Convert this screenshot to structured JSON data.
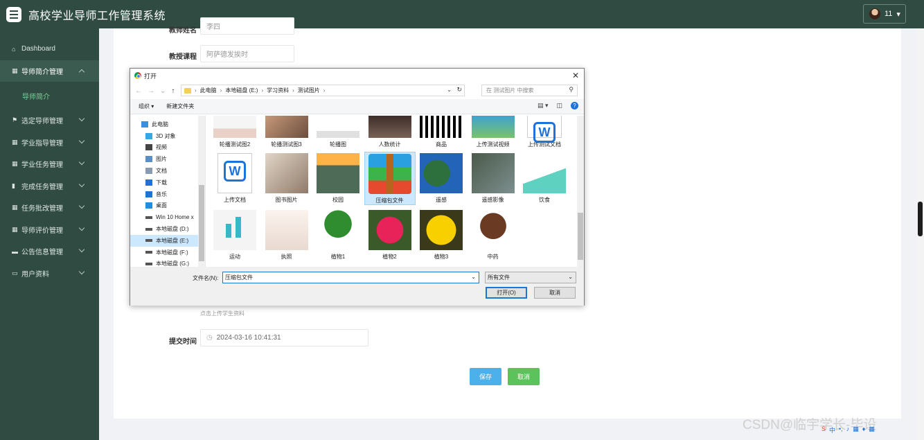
{
  "app": {
    "title": "高校学业导师工作管理系统",
    "user": "11"
  },
  "sidebar": {
    "items": [
      {
        "label": "Dashboard",
        "icon": "home-icon",
        "glyph": "⌂"
      },
      {
        "label": "导师简介管理",
        "icon": "grid-icon",
        "glyph": "▦"
      },
      {
        "label": "选定导师管理",
        "icon": "flag-icon",
        "glyph": "⚑"
      },
      {
        "label": "学业指导管理",
        "icon": "grid-icon",
        "glyph": "▦"
      },
      {
        "label": "学业任务管理",
        "icon": "grid-icon",
        "glyph": "▦"
      },
      {
        "label": "完成任务管理",
        "icon": "bar-chart-icon",
        "glyph": "▮"
      },
      {
        "label": "任务批改管理",
        "icon": "grid-icon",
        "glyph": "▦"
      },
      {
        "label": "导师评价管理",
        "icon": "grid-icon",
        "glyph": "▦"
      },
      {
        "label": "公告信息管理",
        "icon": "comment-icon",
        "glyph": "▬"
      },
      {
        "label": "用户资料",
        "icon": "card-icon",
        "glyph": "▭"
      }
    ],
    "sub_item": "导师简介"
  },
  "form": {
    "field_top_label": "教师姓名",
    "field_top_value": "李四",
    "course_label": "教授课程",
    "course_value": "阿萨德发挨时",
    "upload_hint": "点击上传学生资料",
    "submit_time_label": "提交时间",
    "submit_time_value": "2024-03-16 10:41:31",
    "save": "保存",
    "cancel": "取消"
  },
  "dialog": {
    "title": "打开",
    "path": [
      "此电脑",
      "本地磁盘 (E:)",
      "学习资料",
      "测试图片"
    ],
    "search_placeholder": "在 测试图片 中搜索",
    "organize": "组织 ▾",
    "new_folder": "新建文件夹",
    "tree": [
      {
        "label": "此电脑",
        "icon": "computer-icon",
        "color": "#3d8de0"
      },
      {
        "label": "3D 对象",
        "icon": "cube-icon",
        "color": "#38a6e0"
      },
      {
        "label": "视频",
        "icon": "video-icon",
        "color": "#444"
      },
      {
        "label": "图片",
        "icon": "picture-icon",
        "color": "#5a8fc4"
      },
      {
        "label": "文档",
        "icon": "document-icon",
        "color": "#8a9bb0"
      },
      {
        "label": "下载",
        "icon": "download-icon",
        "color": "#1e73d8"
      },
      {
        "label": "音乐",
        "icon": "music-icon",
        "color": "#1e73d8"
      },
      {
        "label": "桌面",
        "icon": "desktop-icon",
        "color": "#1e8ee0"
      },
      {
        "label": "Win 10 Home x",
        "icon": "drive-icon",
        "color": "#555"
      },
      {
        "label": "本地磁盘 (D:)",
        "icon": "drive-icon",
        "color": "#555"
      },
      {
        "label": "本地磁盘 (E:)",
        "icon": "drive-icon",
        "color": "#555"
      },
      {
        "label": "本地磁盘 (F:)",
        "icon": "drive-icon",
        "color": "#555"
      },
      {
        "label": "本地磁盘 (G:)",
        "icon": "drive-icon",
        "color": "#555"
      }
    ],
    "files_row1": [
      "轮播测试图2",
      "轮播测试图3",
      "轮播图",
      "人数统计",
      "商品",
      "上传测试视频",
      "上传测试文档"
    ],
    "files_row2": [
      "上传文档",
      "图书图片",
      "校园",
      "压缩包文件",
      "遥感",
      "遥感影像",
      "饮食"
    ],
    "files_row3": [
      "运动",
      "执照",
      "植物1",
      "植物2",
      "植物3",
      "中药"
    ],
    "filename_label": "文件名(N):",
    "filename_value": "压缩包文件",
    "filetype": "所有文件",
    "open_btn": "打开(O)",
    "cancel_btn": "取消"
  },
  "watermark": "CSDN@临宇学长-毕设",
  "colors": {
    "sidebar": "#304c42",
    "save": "#4cb1ea",
    "cancel": "#5cc35c"
  }
}
